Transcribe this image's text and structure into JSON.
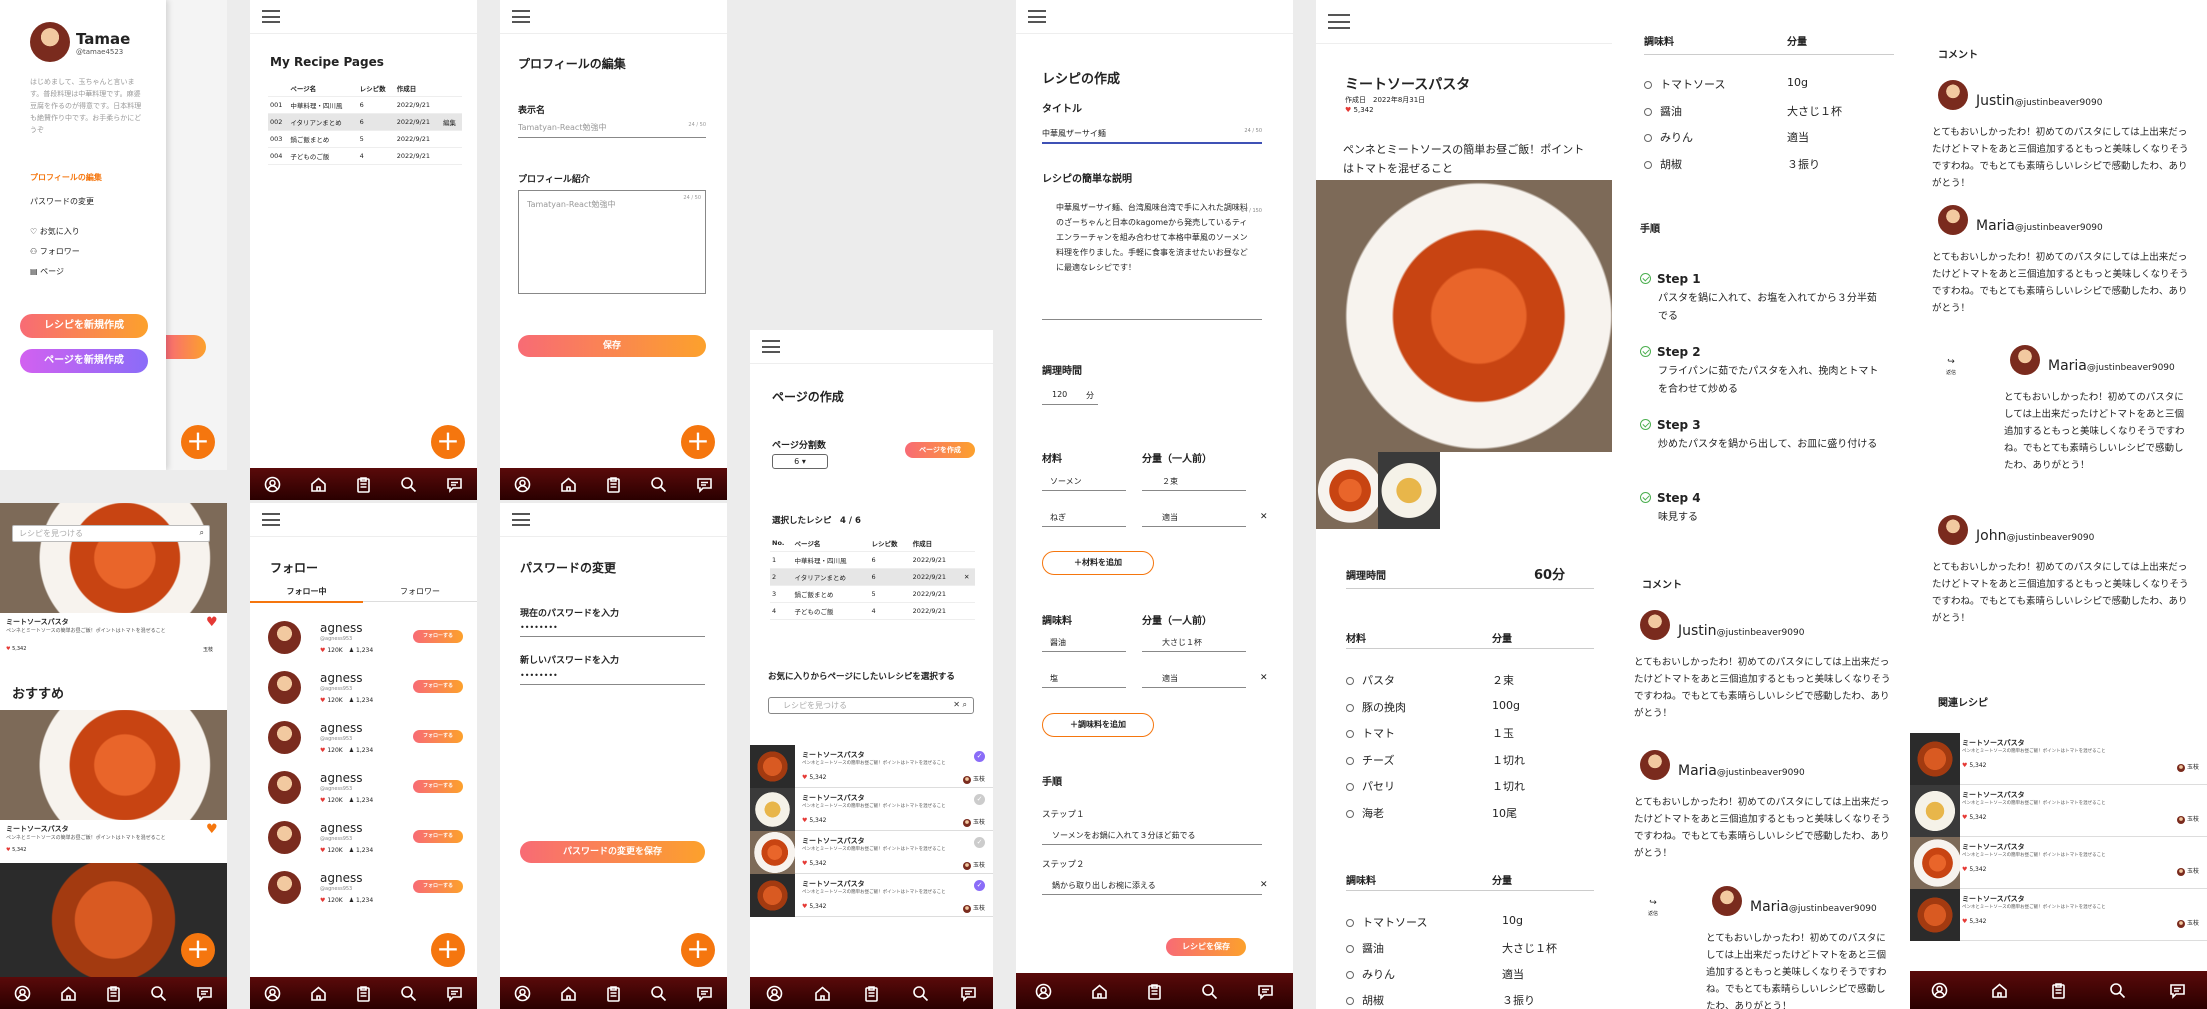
{
  "s1": {
    "user_name": "Tamae",
    "user_handle": "@tamae4523",
    "bio": "はじめまして、玉ちゃんと言います。普段料理は中華料理です。麻婆豆腐を作るのが得意です。日本料理も絶賛作り中です。お手柔らかにどうぞ",
    "menu_profile_edit": "プロフィールの編集",
    "menu_password": "パスワードの変更",
    "fav": "お気に入り",
    "follow": "フォロワー",
    "page": "ページ",
    "btn_new_recipe": "レシピを新規作成",
    "btn_new_page": "ページを新規作成"
  },
  "s2": {
    "title": "My Recipe Pages",
    "headers": [
      "",
      "ページ名",
      "レシピ数",
      "作成日",
      ""
    ],
    "rows": [
      [
        "001",
        "中華料理・四川風",
        "6",
        "2022/9/21",
        ""
      ],
      [
        "002",
        "イタリアンまとめ",
        "6",
        "2022/9/21",
        "編集"
      ],
      [
        "003",
        "鍋ご飯まとめ",
        "5",
        "2022/9/21",
        ""
      ],
      [
        "004",
        "子どものご飯",
        "4",
        "2022/9/21",
        ""
      ]
    ]
  },
  "s3": {
    "title": "プロフィールの編集",
    "display_name_label": "表示名",
    "display_name_value": "Tamatyan-React勉強中",
    "display_name_count": "24 / 50",
    "intro_label": "プロフィール紹介",
    "intro_value": "Tamatyan-React勉強中",
    "intro_count": "24 / 50",
    "save": "保存"
  },
  "s4": {
    "search_placeholder": "レシピを見つける",
    "recipe_title": "ミートソースパスタ",
    "recipe_desc": "ペンネとミートソースの簡単お昼ご飯！ポイントはトマトを混ぜること",
    "likes": "5,342",
    "author": "玉枝",
    "recommend": "おすすめ"
  },
  "s5": {
    "title": "フォロー",
    "tab_following": "フォロー中",
    "tab_followers": "フォロワー",
    "users": [
      {
        "name": "agness",
        "handle": "@agness953",
        "stat1": "120K",
        "stat2": "1,234",
        "btn": "フォローする"
      },
      {
        "name": "agness",
        "handle": "@agness953",
        "stat1": "120K",
        "stat2": "1,234",
        "btn": "フォローする"
      },
      {
        "name": "agness",
        "handle": "@agness953",
        "stat1": "120K",
        "stat2": "1,234",
        "btn": "フォローする"
      },
      {
        "name": "agness",
        "handle": "@agness953",
        "stat1": "120K",
        "stat2": "1,234",
        "btn": "フォローする"
      },
      {
        "name": "agness",
        "handle": "@agness953",
        "stat1": "120K",
        "stat2": "1,234",
        "btn": "フォローする"
      },
      {
        "name": "agness",
        "handle": "@agness953",
        "stat1": "120K",
        "stat2": "1,234",
        "btn": "フォローする"
      }
    ]
  },
  "s6": {
    "title": "パスワードの変更",
    "current_label": "現在のパスワードを入力",
    "current_value": "••••••••",
    "new_label": "新しいパスワードを入力",
    "new_value": "••••••••",
    "save": "パスワードの変更を保存"
  },
  "s7": {
    "title": "ページの作成",
    "split_label": "ページ分割数",
    "split_value": "6",
    "create_btn": "ページを作成",
    "selected_label": "選択したレシピ",
    "selected_count": "4 / 6",
    "headers": [
      "No.",
      "ページ名",
      "レシピ数",
      "作成日",
      ""
    ],
    "rows": [
      [
        "1",
        "中華料理・四川風",
        "6",
        "2022/9/21",
        ""
      ],
      [
        "2",
        "イタリアンまとめ",
        "6",
        "2022/9/21",
        "✕"
      ],
      [
        "3",
        "鍋ご飯まとめ",
        "5",
        "2022/9/21",
        ""
      ],
      [
        "4",
        "子どものご飯",
        "4",
        "2022/9/21",
        ""
      ]
    ],
    "fav_label": "お気に入りからページにしたいレシピを選択する",
    "search_placeholder": "レシピを見つける",
    "recipes": [
      {
        "title": "ミートソースパスタ",
        "desc": "ペンネとミートソースの簡単お昼ご飯！ポイントはトマトを混ぜること",
        "likes": "5,342",
        "author": "玉枝"
      },
      {
        "title": "ミートソースパスタ",
        "desc": "ペンネとミートソースの簡単お昼ご飯！ポイントはトマトを混ぜること",
        "likes": "5,342",
        "author": "玉枝"
      },
      {
        "title": "ミートソースパスタ",
        "desc": "ペンネとミートソースの簡単お昼ご飯！ポイントはトマトを混ぜること",
        "likes": "5,342",
        "author": "玉枝"
      },
      {
        "title": "ミートソースパスタ",
        "desc": "ペンネとミートソースの簡単お昼ご飯！ポイントはトマトを混ぜること",
        "likes": "5,342",
        "author": "玉枝"
      }
    ]
  },
  "s8": {
    "title": "レシピの作成",
    "title_label": "タイトル",
    "title_value": "中華風ザーサイ麺",
    "title_count": "24 / 50",
    "desc_label": "レシピの簡単な説明",
    "desc_value": "中華風ザーサイ麺、台湾風味台湾で手に入れた調味料のざーちゃんと日本のkagomeから発売しているティエンラーチャンを組み合わせて本格中華風のソーメン料理を作りました。手軽に食事を済ませたいお昼などに最適なレシピです！",
    "desc_count": "24 / 150",
    "time_label": "調理時間",
    "time_value": "120",
    "time_unit": "分",
    "ing_label": "材料",
    "qty_label": "分量（一人前）",
    "ingredients": [
      [
        "ソーメン",
        "２束"
      ],
      [
        "ねぎ",
        "適当"
      ]
    ],
    "add_ing": "＋材料を追加",
    "seas_label": "調味料",
    "seasonings": [
      [
        "醤油",
        "大さじ１杯"
      ],
      [
        "塩",
        "適当"
      ]
    ],
    "add_seas": "＋調味料を追加",
    "steps_label": "手順",
    "step1_label": "ステップ１",
    "step1": "ソーメンをお鍋に入れて３分ほど茹でる",
    "step2_label": "ステップ２",
    "step2": "鍋から取り出しお椀に添える",
    "save": "レシピを保存"
  },
  "s9": {
    "title": "ミートソースパスタ",
    "date": "作成日　2022年8月31日",
    "likes": "5,342",
    "desc": "ペンネとミートソースの簡単お昼ご飯！ポイントはトマトを混ぜること",
    "time_label": "調理時間",
    "time_value": "60分",
    "ing_label": "材料",
    "qty_label": "分量",
    "ingredients": [
      [
        "パスタ",
        "２束"
      ],
      [
        "豚の挽肉",
        "100g"
      ],
      [
        "トマト",
        "１玉"
      ],
      [
        "チーズ",
        "１切れ"
      ],
      [
        "パセリ",
        "１切れ"
      ],
      [
        "海老",
        "10尾"
      ]
    ],
    "seas_label": "調味料",
    "seasonings": [
      [
        "トマトソース",
        "10g"
      ],
      [
        "醤油",
        "大さじ１杯"
      ],
      [
        "みりん",
        "適当"
      ],
      [
        "胡椒",
        "３振り"
      ]
    ]
  },
  "s10": {
    "seas_label": "調味料",
    "qty_label": "分量",
    "seasonings": [
      [
        "トマトソース",
        "10g"
      ],
      [
        "醤油",
        "大さじ１杯"
      ],
      [
        "みりん",
        "適当"
      ],
      [
        "胡椒",
        "３振り"
      ]
    ],
    "steps_label": "手順",
    "steps": [
      {
        "title": "Step 1",
        "text": "パスタを鍋に入れて、お塩を入れてから３分半茹でる"
      },
      {
        "title": "Step 2",
        "text": "フライパンに茹でたパスタを入れ、挽肉とトマトを合わせて炒める"
      },
      {
        "title": "Step 3",
        "text": "炒めたパスタを鍋から出して、お皿に盛り付ける"
      },
      {
        "title": "Step 4",
        "text": "味見する"
      }
    ],
    "comments_label": "コメント",
    "comments": [
      {
        "name": "Justin",
        "handle": "@justinbeaver9090",
        "text": "とてもおいしかったわ！初めてのパスタにしては上出来だったけどトマトをあと三個追加するともっと美味しくなりそうですわね。でもとても素晴らしいレシピで感動したわ、ありがとう！"
      },
      {
        "name": "Maria",
        "handle": "@justinbeaver9090",
        "text": "とてもおいしかったわ！初めてのパスタにしては上出来だったけどトマトをあと三個追加するともっと美味しくなりそうですわね。でもとても素晴らしいレシピで感動したわ、ありがとう！"
      },
      {
        "name": "Maria",
        "handle": "@justinbeaver9090",
        "text": "とてもおいしかったわ！初めてのパスタにしては上出来だったけどトマトをあと三個追加するともっと美味しくなりそうですわね。でもとても素晴らしいレシピで感動したわ、ありがとう！"
      }
    ],
    "reply": "返信"
  },
  "s11": {
    "comments_label": "コメント",
    "comments": [
      {
        "name": "Justin",
        "handle": "@justinbeaver9090",
        "text": "とてもおいしかったわ！初めてのパスタにしては上出来だったけどトマトをあと三個追加するともっと美味しくなりそうですわね。でもとても素晴らしいレシピで感動したわ、ありがとう！"
      },
      {
        "name": "Maria",
        "handle": "@justinbeaver9090",
        "text": "とてもおいしかったわ！初めてのパスタにしては上出来だったけどトマトをあと三個追加するともっと美味しくなりそうですわね。でもとても素晴らしいレシピで感動したわ、ありがとう！"
      },
      {
        "name": "Maria",
        "handle": "@justinbeaver9090",
        "text": "とてもおいしかったわ！初めてのパスタにしては上出来だったけどトマトをあと三個追加するともっと美味しくなりそうですわね。でもとても素晴らしいレシピで感動したわ、ありがとう！"
      },
      {
        "name": "John",
        "handle": "@justinbeaver9090",
        "text": "とてもおいしかったわ！初めてのパスタにしては上出来だったけどトマトをあと三個追加するともっと美味しくなりそうですわね。でもとても素晴らしいレシピで感動したわ、ありがとう！"
      }
    ],
    "reply": "返信",
    "related_label": "関連レシピ",
    "recipes": [
      {
        "title": "ミートソースパスタ",
        "desc": "ペンネとミートソースの簡単お昼ご飯！ポイントはトマトを混ぜること",
        "likes": "5,342",
        "author": "玉枝"
      },
      {
        "title": "ミートソースパスタ",
        "desc": "ペンネとミートソースの簡単お昼ご飯！ポイントはトマトを混ぜること",
        "likes": "5,342",
        "author": "玉枝"
      },
      {
        "title": "ミートソースパスタ",
        "desc": "ペンネとミートソースの簡単お昼ご飯！ポイントはトマトを混ぜること",
        "likes": "5,342",
        "author": "玉枝"
      },
      {
        "title": "ミートソースパスタ",
        "desc": "ペンネとミートソースの簡単お昼ご飯！ポイントはトマトを混ぜること",
        "likes": "5,342",
        "author": "玉枝"
      }
    ]
  }
}
